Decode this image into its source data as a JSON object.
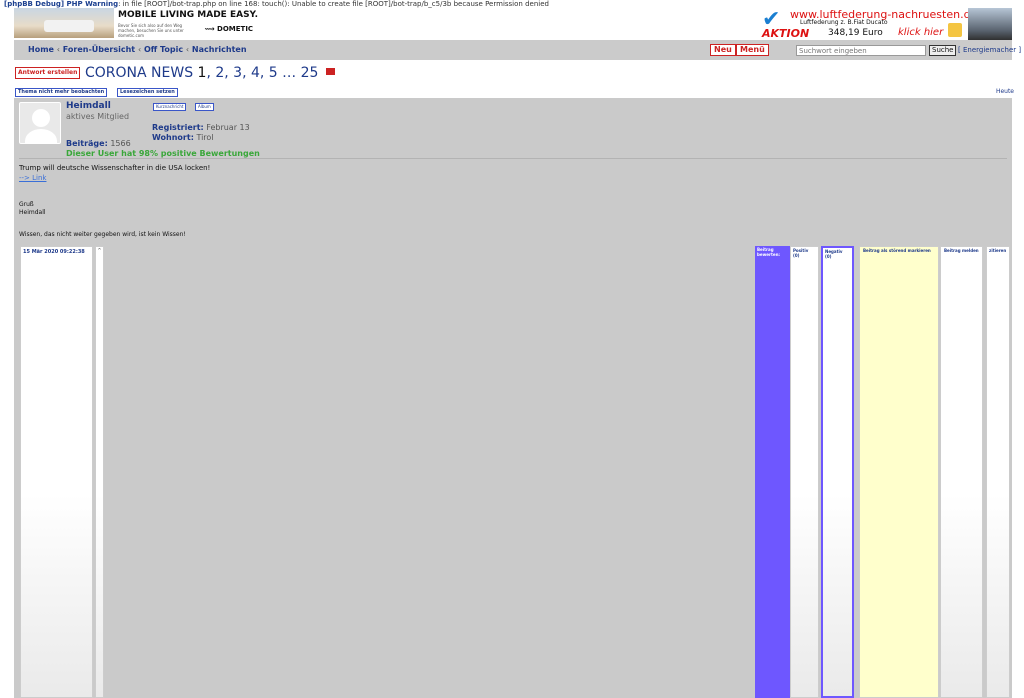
{
  "debug": {
    "prefix": "[phpBB Debug] PHP Warning",
    "text": ": in file [ROOT]/bot-trap.php on line 168: touch(): Unable to create file [ROOT]/bot-trap/b_c5/3b because Permission denied"
  },
  "ads": {
    "left": {
      "title": "MOBILE LIVING MADE EASY.",
      "sub": "Bevor Sie sich also auf den Weg machen, besuchen Sie uns unter dometic.com",
      "brand": "DOMETIC"
    },
    "right": {
      "url": "www.luftfederung-nachruesten.de",
      "line2": "Luftfederung z. B.Fiat Ducato",
      "aktion": "AKTION",
      "price": "348,19 Euro",
      "klick": "klick hier"
    }
  },
  "nav": {
    "home": "Home",
    "forum_index": "Foren-Übersicht",
    "off_topic": "Off Topic",
    "news": "Nachrichten",
    "sep": "‹",
    "neu": "Neu",
    "menu": "Menü",
    "search_placeholder": "Suchwort eingeben",
    "search_button": "Suche",
    "energie": "[ Energiemacher ]"
  },
  "thread": {
    "reply_button": "Antwort erstellen",
    "title": "CORONA NEWS",
    "current_page": "1",
    "pages_visible": ", 2, 3, 4, 5 … 25",
    "watch": "Thema nicht mehr beobachten",
    "bookmark": "Lesezeichen setzen",
    "today": "Heute"
  },
  "post": {
    "username": "Heimdall",
    "rank": "aktives Mitglied",
    "pm": "Kurznachricht",
    "album": "Album",
    "registered_label": "Registriert:",
    "registered_value": "Februar 13",
    "location_label": "Wohnort:",
    "location_value": "Tirol",
    "posts_label": "Beiträge:",
    "posts_value": "1566",
    "rating": "Dieser User hat 98% positive Bewertungen",
    "body": "Trump will deutsche Wissenschafter in die USA locken!",
    "link": "--> Link",
    "greeting1": "Gruß",
    "greeting2": "Heimdall",
    "signature": "Wissen, das nicht weiter gegeben wird, ist kein Wissen!",
    "date": "15 Mär 2020 09:22:38",
    "up_symbol": "^",
    "rate_label": "Beitrag bewerten:",
    "positive": "Positiv (0)",
    "negative": "Negativ (0)",
    "mark_disturbing": "Beitrag als störend markieren",
    "report": "Beitrag melden",
    "quote": "zitieren"
  }
}
